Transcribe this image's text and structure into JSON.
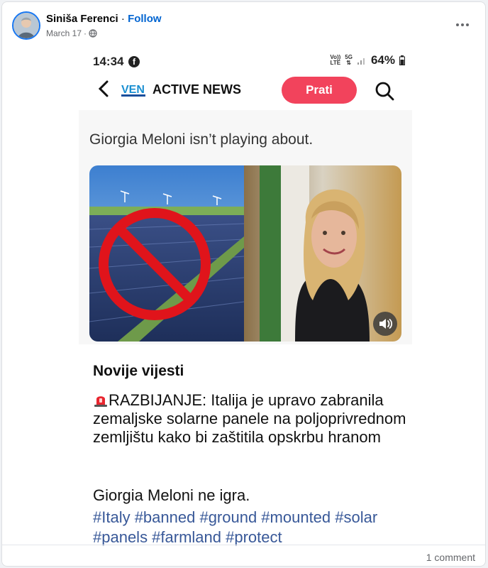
{
  "post": {
    "author": "Siniša Ferenci",
    "separator": "·",
    "follow_label": "Follow",
    "date": "March 17",
    "date_separator": "·",
    "privacy_icon": "globe-icon",
    "more_icon": "ellipsis-icon"
  },
  "screenshot": {
    "status_bar": {
      "time": "14:34",
      "app_icon": "facebook-icon",
      "network_label_top": "Vo))",
      "network_label_bottom": "LTE",
      "data_label": "5G",
      "battery": "64%"
    },
    "app_bar": {
      "back_icon": "chevron-left-icon",
      "logo_text": "VEN",
      "brand_name": "ACTIVE NEWS",
      "follow_button": "Prati",
      "search_icon": "search-icon"
    },
    "tweet": {
      "text": "Giorgia Meloni isn’t playing about.",
      "sound_icon": "volume-icon"
    },
    "article": {
      "heading": "Novije vijesti",
      "alert_icon": "siren-icon",
      "body": "RAZBIJANJE: Italija je upravo zabranila zemaljske solarne panele na poljoprivrednom zemljištu kako bi zaštitila opskrbu hranom",
      "subline": "Giorgia Meloni ne igra.",
      "hashtags": "#Italy #banned #ground #mounted #solar #panels #farmland #protect"
    }
  },
  "footer": {
    "comment_count": "1 comment"
  },
  "colors": {
    "follow_link": "#0064d1",
    "prati_button": "#f2435c",
    "hashtag": "#385898",
    "avatar_ring": "#1877f2"
  }
}
